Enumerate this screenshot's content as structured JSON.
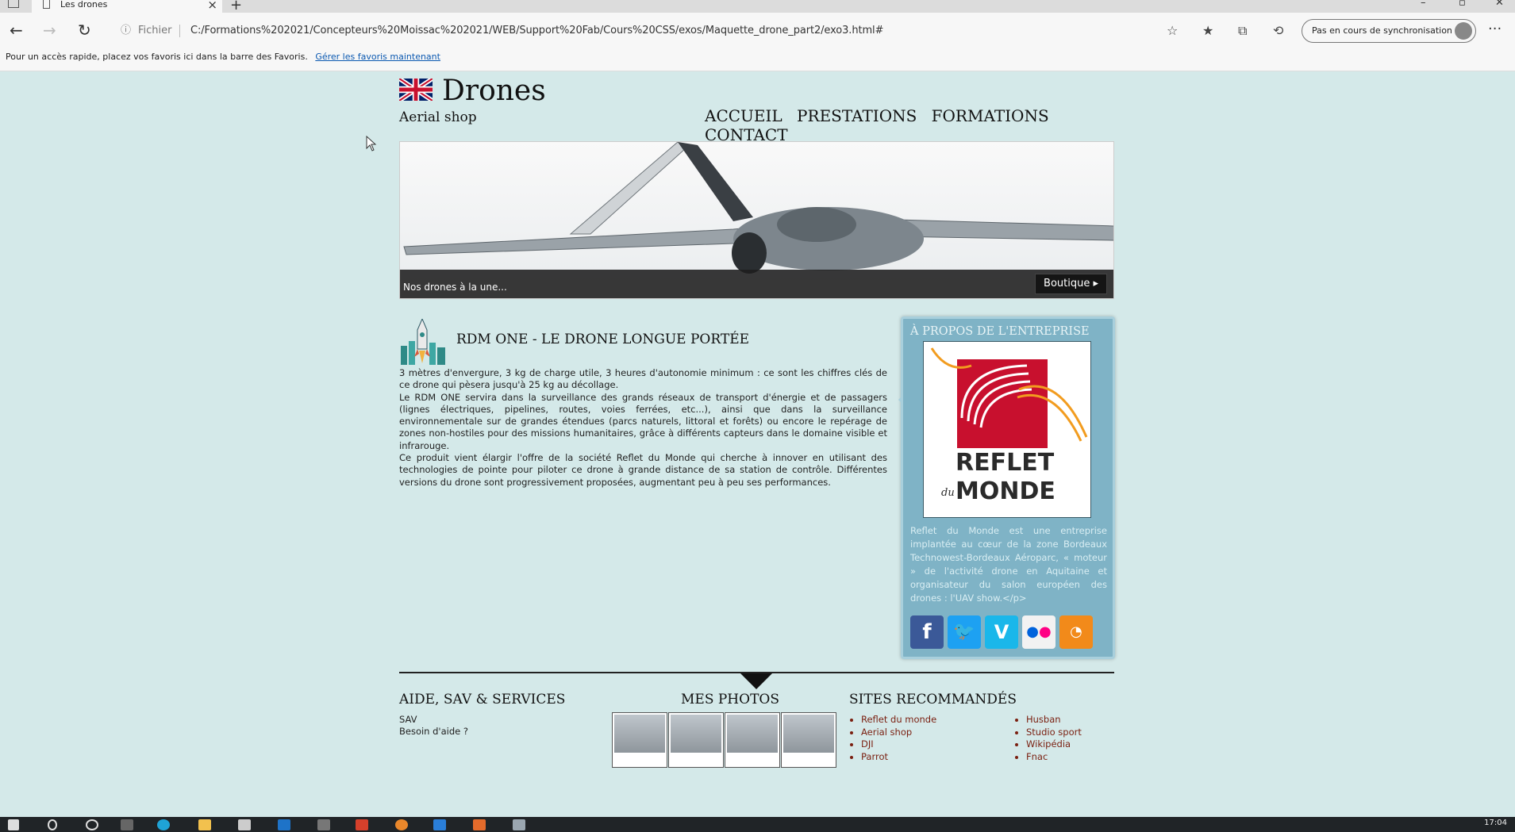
{
  "browser": {
    "tab_title": "Les drones",
    "address_prefix": "Fichier",
    "url": "C:/Formations%202021/Concepteurs%20Moissac%202021/WEB/Support%20Fab/Cours%20CSS/exos/Maquette_drone_part2/exo3.html#",
    "sync_label": "Pas en cours de synchronisation",
    "favorites_text": "Pour un accès rapide, placez vos favoris ici dans la barre des Favoris.",
    "favorites_link": "Gérer les favoris maintenant"
  },
  "site": {
    "title": "Drones",
    "subtitle": "Aerial shop",
    "nav": [
      "ACCUEIL",
      "PRESTATIONS",
      "FORMATIONS",
      "CONTACT"
    ]
  },
  "hero": {
    "caption": "Nos drones à la une...",
    "button": "Boutique ▸"
  },
  "article": {
    "title": "RDM ONE - LE DRONE LONGUE PORTÉE",
    "paragraphs": [
      "3 mètres d'envergure, 3 kg de charge utile, 3 heures d'autonomie minimum : ce sont les chiffres clés de ce drone qui pèsera jusqu'à 25 kg au décollage.",
      "Le RDM ONE servira dans la surveillance des grands réseaux de transport d'énergie et de passagers (lignes électriques, pipelines, routes, voies ferrées, etc...), ainsi que dans la surveillance environnementale sur de grandes étendues (parcs naturels, littoral et forêts) ou encore le repérage de zones non-hostiles pour des missions humanitaires, grâce à différents capteurs dans le domaine visible et infrarouge.",
      "Ce produit vient élargir l'offre de la société Reflet du Monde qui cherche à innover en utilisant des technologies de pointe pour piloter ce drone à grande distance de sa station de contrôle. Différentes versions du drone sont progressivement proposées, augmentant peu à peu ses performances."
    ]
  },
  "aside": {
    "title": "À PROPOS DE L'ENTREPRISE",
    "logo_text": "REFLET",
    "logo_small": "du",
    "logo_text2": "MONDE",
    "text": "Reflet du Monde est une entreprise implantée au cœur de la zone Bordeaux Technowest-Bordeaux Aéroparc, « moteur » de l'activité drone en Aquitaine et organisateur du salon européen des drones : l'UAV show.</p>",
    "social": [
      {
        "name": "facebook",
        "glyph": "f",
        "color": "#3b5998"
      },
      {
        "name": "twitter",
        "glyph": "t",
        "color": "#1da1f2"
      },
      {
        "name": "vimeo",
        "glyph": "V",
        "color": "#1ab7ea"
      },
      {
        "name": "flickr",
        "glyph": "●●",
        "color": "#f2f2f2"
      },
      {
        "name": "rss",
        "glyph": "))",
        "color": "#f28a1a"
      }
    ]
  },
  "footer": {
    "help_title": "AIDE, SAV & SERVICES",
    "help_links": [
      "SAV",
      "Besoin d'aide ?"
    ],
    "photos_title": "MES PHOTOS",
    "sites_title": "SITES RECOMMANDÉS",
    "sites_col1": [
      "Reflet du monde",
      "Aerial shop",
      "DJI",
      "Parrot"
    ],
    "sites_col2": [
      "Husban",
      "Studio sport",
      "Wikipédia",
      "Fnac"
    ]
  },
  "taskbar": {
    "clock": "17:04"
  },
  "colors": {
    "page_bg": "#d4e9e9",
    "aside_bg": "#7fb3c6",
    "link_red": "#7a1f10"
  }
}
